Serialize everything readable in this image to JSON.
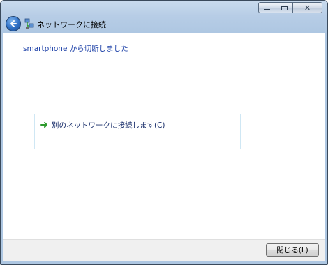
{
  "window": {
    "title": "ネットワークに接続"
  },
  "content": {
    "status_text": "smartphone から切断しました",
    "option_label": "別のネットワークに接続します(C)"
  },
  "footer": {
    "close_button_label": "閉じる(L)"
  },
  "icons": {
    "back": "back-arrow-icon",
    "network": "network-connect-icon",
    "option": "green-arrow-icon",
    "minimize": "minimize-icon",
    "maximize": "maximize-icon",
    "close": "close-icon"
  },
  "colors": {
    "title_bar": "#b7cde6",
    "status_text": "#1b3fa7",
    "option_border": "#cfe7f4",
    "arrow_green": "#2e9a2e"
  }
}
